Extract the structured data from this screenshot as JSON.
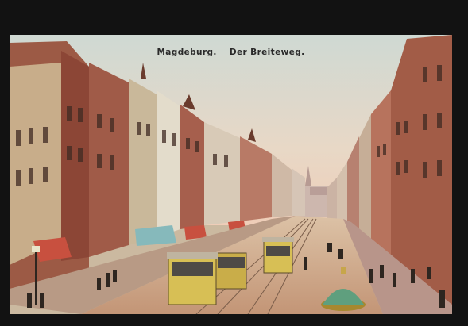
{
  "caption": {
    "city": "Magdeburg.",
    "street": "Der Breiteweg."
  },
  "colors": {
    "border": "#121212",
    "sky": "#d9dfd6",
    "brick": "#8a4a3a",
    "stone": "#b9a08a",
    "street": "#c9a98c",
    "tram": "#d8c04a",
    "awning": "#7fb0b0"
  }
}
